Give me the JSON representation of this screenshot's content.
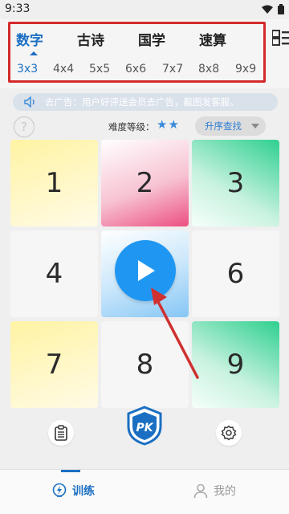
{
  "status": {
    "time": "9:33"
  },
  "categories": [
    {
      "label": "数字",
      "active": true
    },
    {
      "label": "古诗",
      "active": false
    },
    {
      "label": "国学",
      "active": false
    },
    {
      "label": "速算",
      "active": false
    }
  ],
  "sizes": [
    {
      "label": "3x3",
      "active": true
    },
    {
      "label": "4x4",
      "active": false
    },
    {
      "label": "5x5",
      "active": false
    },
    {
      "label": "6x6",
      "active": false
    },
    {
      "label": "7x7",
      "active": false
    },
    {
      "label": "8x8",
      "active": false
    },
    {
      "label": "9x9",
      "active": false
    }
  ],
  "notice": {
    "text": "去广告：用户好评送会员去广告，截图发客服。"
  },
  "help": {
    "glyph": "?"
  },
  "difficulty": {
    "label": "难度等级：",
    "stars": "★★",
    "level": 2
  },
  "sort": {
    "label": "升序查找"
  },
  "grid": {
    "cells": [
      "1",
      "2",
      "3",
      "4",
      "",
      "6",
      "7",
      "8",
      "9"
    ]
  },
  "tabs": [
    {
      "label": "训练",
      "active": true
    },
    {
      "label": "我的",
      "active": false
    }
  ],
  "colors": {
    "accent": "#1b6fc2",
    "play": "#1f97f2",
    "highlight_box": "#d42a2a"
  }
}
